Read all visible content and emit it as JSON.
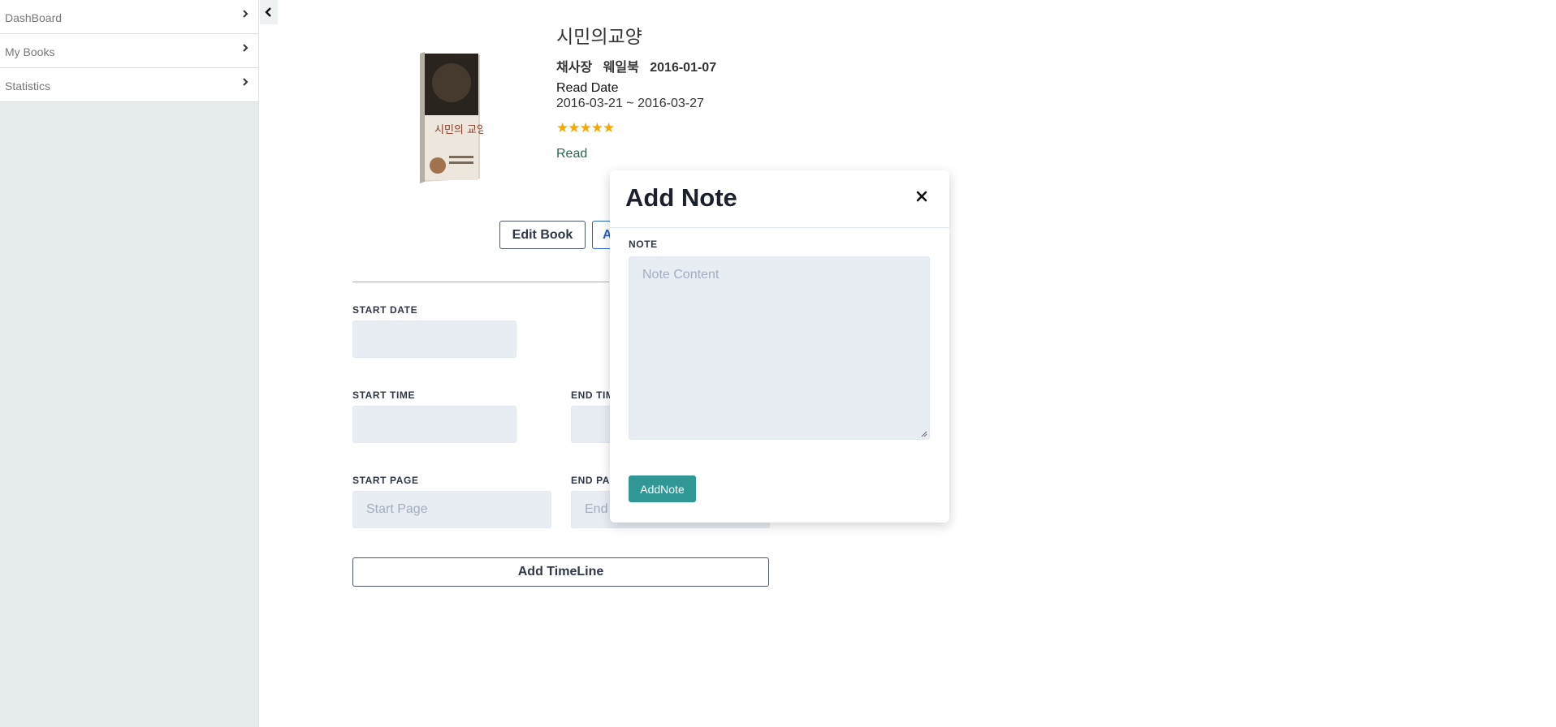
{
  "sidebar": {
    "items": [
      {
        "label": "DashBoard"
      },
      {
        "label": "My Books"
      },
      {
        "label": "Statistics"
      }
    ]
  },
  "book": {
    "title": "시민의교양",
    "author": "채사장",
    "publisher": "웨일북",
    "published_date": "2016-01-07",
    "read_date_label": "Read Date",
    "read_date_range": "2016-03-21 ~ 2016-03-27",
    "rating": 5,
    "rating_display": "★★★★★",
    "status": "Read",
    "cover_title": "시민의 교양"
  },
  "actions": {
    "edit_book": "Edit Book",
    "add_note_partial": "A"
  },
  "timeline_form": {
    "start_date_label": "START DATE",
    "start_time_label": "START TIME",
    "end_time_label": "END TIM",
    "start_page_label": "START PAGE",
    "start_page_placeholder": "Start Page",
    "end_page_label": "END PA",
    "end_page_placeholder": "End",
    "submit_label": "Add TimeLine"
  },
  "modal": {
    "title": "Add Note",
    "note_label": "NOTE",
    "note_placeholder": "Note Content",
    "submit_label": "AddNote"
  },
  "colors": {
    "accent_teal": "#319795",
    "star": "#f6a800",
    "status_green": "#276749",
    "sidebar_bg": "#e6ecec"
  }
}
